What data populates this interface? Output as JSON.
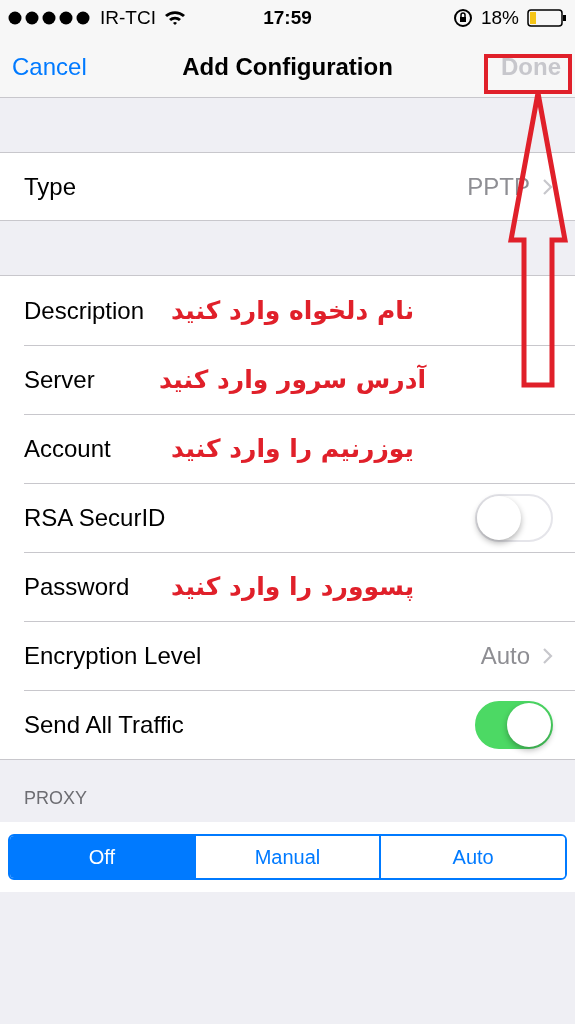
{
  "status_bar": {
    "carrier": "IR-TCI",
    "time": "17:59",
    "battery": "18%"
  },
  "nav": {
    "cancel": "Cancel",
    "title": "Add Configuration",
    "done": "Done",
    "done_disabled": true
  },
  "type_row": {
    "label": "Type",
    "value": "PPTP"
  },
  "rows": [
    {
      "kind": "field",
      "label": "Description",
      "annotation": "نام دلخواه وارد کنید"
    },
    {
      "kind": "field",
      "label": "Server",
      "annotation": "آدرس سرور وارد کنید"
    },
    {
      "kind": "field",
      "label": "Account",
      "annotation": "یوزرنیم را وارد کنید"
    },
    {
      "kind": "toggle",
      "label": "RSA SecurID",
      "on": false
    },
    {
      "kind": "field",
      "label": "Password",
      "annotation": "پسوورد را وارد کنید"
    },
    {
      "kind": "disclosure",
      "label": "Encryption Level",
      "value": "Auto"
    },
    {
      "kind": "toggle",
      "label": "Send All Traffic",
      "on": true
    }
  ],
  "proxy": {
    "header": "PROXY",
    "segments": [
      {
        "label": "Off",
        "selected": true
      },
      {
        "label": "Manual",
        "selected": false
      },
      {
        "label": "Auto",
        "selected": false
      }
    ]
  }
}
